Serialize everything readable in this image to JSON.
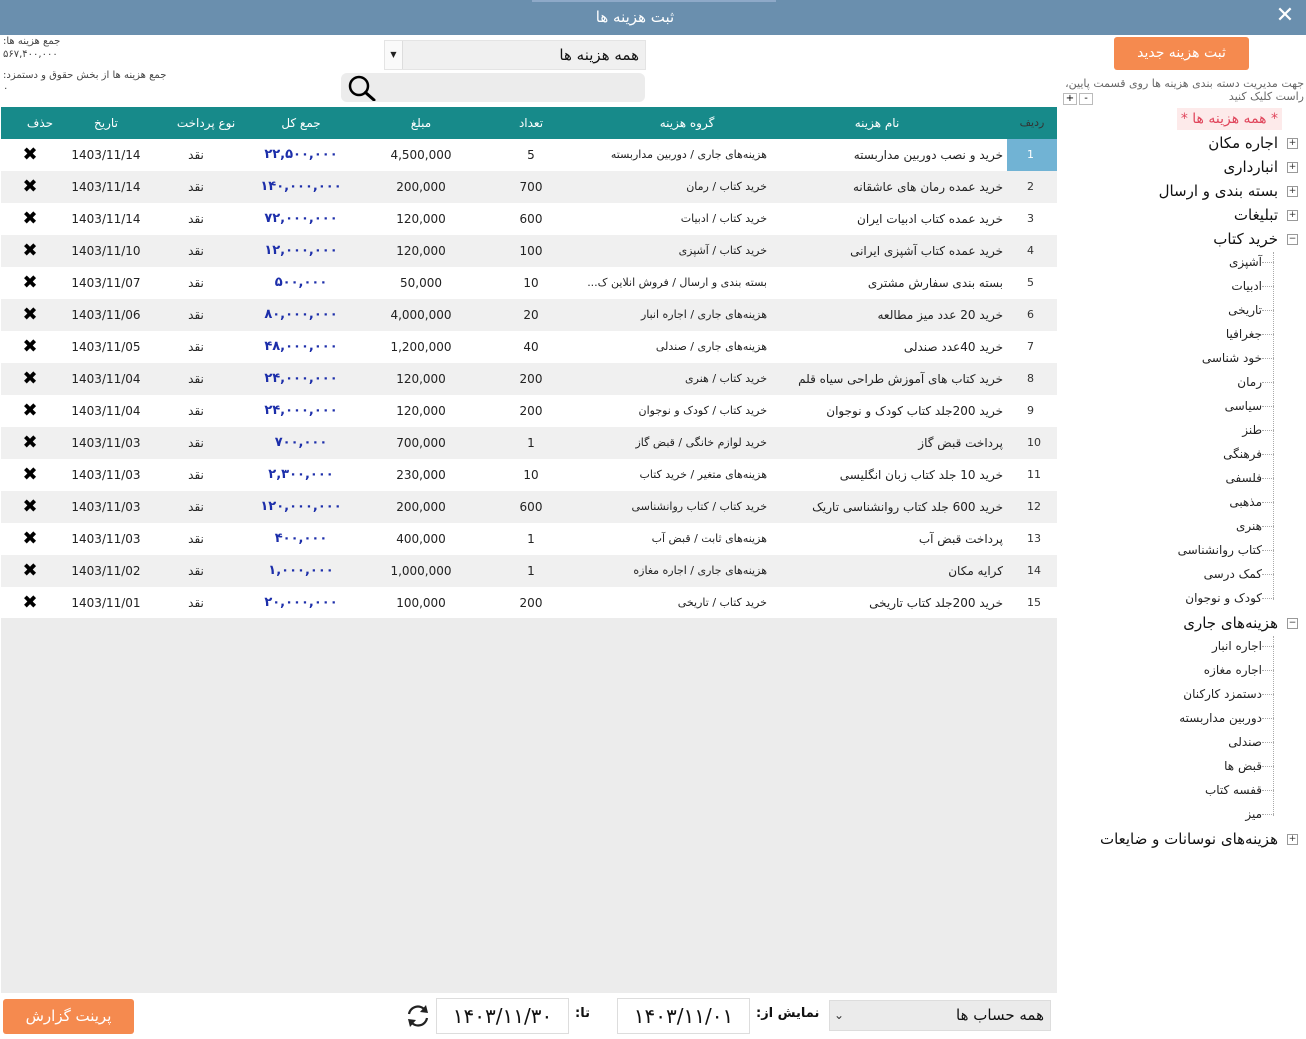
{
  "window": {
    "title": "ثبت هزینه ها",
    "close_icon": "close-icon"
  },
  "totals": {
    "label1": "جمع هزینه ها:",
    "value1": "۵۶۷,۴۰۰,۰۰۰",
    "label2": "جمع هزینه ها از بخش حقوق و دستمزد:",
    "value2": "۰"
  },
  "filter": {
    "category_selected": "همه هزینه ها",
    "search_placeholder": ""
  },
  "sidebar": {
    "new_button": "ثبت هزینه جدید",
    "hint": "جهت مدیریت دسته بندی هزینه ها روی قسمت پایین، راست کلیک کنید",
    "expand_all": "+",
    "collapse_all": "-",
    "all_label": "* همه هزینه ها *",
    "categories": [
      {
        "label": "اجاره مکان",
        "expanded": false,
        "children": []
      },
      {
        "label": "انبارداری",
        "expanded": false,
        "children": []
      },
      {
        "label": "بسته بندی و ارسال",
        "expanded": false,
        "children": []
      },
      {
        "label": "تبلیغات",
        "expanded": false,
        "children": []
      },
      {
        "label": "خرید کتاب",
        "expanded": true,
        "children": [
          "آشپزی",
          "ادبیات",
          "تاریخی",
          "جغرافیا",
          "خود شناسی",
          "رمان",
          "سیاسی",
          "طنز",
          "فرهنگی",
          "فلسفی",
          "مذهبی",
          "هنری",
          "کتاب روانشناسی",
          "کمک درسی",
          "کودک و نوجوان"
        ]
      },
      {
        "label": "هزینه‌های جاری",
        "expanded": true,
        "children": [
          "اجاره انبار",
          "اجاره مغازه",
          "دستمزد کارکنان",
          "دوربین مداربسته",
          "صندلی",
          "قبض ها",
          "قفسه کتاب",
          "میز"
        ]
      },
      {
        "label": "هزینه‌های نوسانات و ضایعات",
        "expanded": false,
        "children": []
      }
    ]
  },
  "table": {
    "headers": {
      "idx": "ردیف",
      "name": "نام هزینه",
      "group": "گروه هزینه",
      "qty": "تعداد",
      "price": "مبلغ",
      "total": "جمع کل",
      "type": "نوع پرداخت",
      "date": "تاریخ",
      "del": "حذف"
    },
    "rows": [
      {
        "idx": "1",
        "name": "خرید و نصب دوربین مداربسته",
        "group": "هزینه‌های جاری / دوربین مداربسته",
        "qty": "5",
        "price": "4,500,000",
        "total": "۲۲,۵۰۰,۰۰۰",
        "type": "نقد",
        "date": "1403/11/14",
        "del": "✖"
      },
      {
        "idx": "2",
        "name": "خرید عمده رمان های عاشقانه",
        "group": "خرید کتاب  / رمان",
        "qty": "700",
        "price": "200,000",
        "total": "۱۴۰,۰۰۰,۰۰۰",
        "type": "نقد",
        "date": "1403/11/14",
        "del": "✖"
      },
      {
        "idx": "3",
        "name": "خرید عمده کتاب ادبیات ایران",
        "group": "خرید کتاب  / ادبیات",
        "qty": "600",
        "price": "120,000",
        "total": "۷۲,۰۰۰,۰۰۰",
        "type": "نقد",
        "date": "1403/11/14",
        "del": "✖"
      },
      {
        "idx": "4",
        "name": "خرید عمده کتاب آشپزی ایرانی",
        "group": "خرید کتاب  / آشپزی",
        "qty": "100",
        "price": "120,000",
        "total": "۱۲,۰۰۰,۰۰۰",
        "type": "نقد",
        "date": "1403/11/10",
        "del": "✖"
      },
      {
        "idx": "5",
        "name": "بسته بندی سفارش مشتری",
        "group": "بسته بندی و ارسال / فروش انلاین ک...",
        "qty": "10",
        "price": "50,000",
        "total": "۵۰۰,۰۰۰",
        "type": "نقد",
        "date": "1403/11/07",
        "del": "✖"
      },
      {
        "idx": "6",
        "name": "خرید 20 عدد میز مطالعه",
        "group": "هزینه‌های جاری / اجاره انبار",
        "qty": "20",
        "price": "4,000,000",
        "total": "۸۰,۰۰۰,۰۰۰",
        "type": "نقد",
        "date": "1403/11/06",
        "del": "✖"
      },
      {
        "idx": "7",
        "name": "خرید 40عدد صندلی",
        "group": "هزینه‌های جاری / صندلی",
        "qty": "40",
        "price": "1,200,000",
        "total": "۴۸,۰۰۰,۰۰۰",
        "type": "نقد",
        "date": "1403/11/05",
        "del": "✖"
      },
      {
        "idx": "8",
        "name": "خرید کتاب های آموزش طراحی سیاه قلم",
        "group": "خرید کتاب  / هنری",
        "qty": "200",
        "price": "120,000",
        "total": "۲۴,۰۰۰,۰۰۰",
        "type": "نقد",
        "date": "1403/11/04",
        "del": "✖"
      },
      {
        "idx": "9",
        "name": "خرید 200جلد کتاب کودک و نوجوان",
        "group": "خرید کتاب  / کودک و نوجوان",
        "qty": "200",
        "price": "120,000",
        "total": "۲۴,۰۰۰,۰۰۰",
        "type": "نقد",
        "date": "1403/11/04",
        "del": "✖"
      },
      {
        "idx": "10",
        "name": "پرداخت قبض گاز",
        "group": "خرید لوازم خانگی / قبض گاز",
        "qty": "1",
        "price": "700,000",
        "total": "۷۰۰,۰۰۰",
        "type": "نقد",
        "date": "1403/11/03",
        "del": "✖"
      },
      {
        "idx": "11",
        "name": "خرید 10 جلد کتاب زبان انگلیسی",
        "group": "هزینه‌های متغیر / خرید کتاب",
        "qty": "10",
        "price": "230,000",
        "total": "۲,۳۰۰,۰۰۰",
        "type": "نقد",
        "date": "1403/11/03",
        "del": "✖"
      },
      {
        "idx": "12",
        "name": "خرید 600 جلد کتاب روانشناسی تاریک",
        "group": "خرید کتاب  / کتاب روانشناسی",
        "qty": "600",
        "price": "200,000",
        "total": "۱۲۰,۰۰۰,۰۰۰",
        "type": "نقد",
        "date": "1403/11/03",
        "del": "✖"
      },
      {
        "idx": "13",
        "name": "پرداخت قبض آب",
        "group": "هزینه‌های ثابت / قبض آب",
        "qty": "1",
        "price": "400,000",
        "total": "۴۰۰,۰۰۰",
        "type": "نقد",
        "date": "1403/11/03",
        "del": "✖"
      },
      {
        "idx": "14",
        "name": "کرایه مکان",
        "group": "هزینه‌های جاری / اجاره مغازه",
        "qty": "1",
        "price": "1,000,000",
        "total": "۱,۰۰۰,۰۰۰",
        "type": "نقد",
        "date": "1403/11/02",
        "del": "✖"
      },
      {
        "idx": "15",
        "name": "خرید 200جلد کتاب تاریخی",
        "group": "خرید کتاب  / تاریخی",
        "qty": "200",
        "price": "100,000",
        "total": "۲۰,۰۰۰,۰۰۰",
        "type": "نقد",
        "date": "1403/11/01",
        "del": "✖"
      }
    ]
  },
  "footer": {
    "print_button": "پرینت گزارش",
    "to_label": "تا:",
    "to_date": "۱۴۰۳/۱۱/۳۰",
    "from_label": "نمایش از:",
    "from_date": "۱۴۰۳/۱۱/۰۱",
    "account_selected": "همه حساب ها"
  },
  "colors": {
    "header": "#178a8a",
    "accent": "#f58a4f",
    "titlebar": "#6a8fae",
    "total_text": "#1c2eaa",
    "selected_idx": "#71b3d4"
  }
}
